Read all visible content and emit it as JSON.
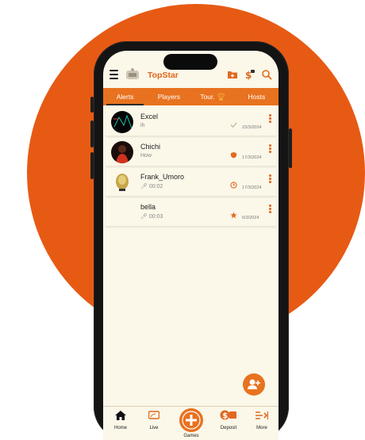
{
  "app": {
    "title": "TopStar"
  },
  "tabs": [
    {
      "label": "Alerts",
      "active": true
    },
    {
      "label": "Players",
      "active": false
    },
    {
      "label": "Tour.",
      "active": false
    },
    {
      "label": "Hosts",
      "active": false
    }
  ],
  "alerts": [
    {
      "name": "Excel",
      "subtitle": "ih",
      "status_icon": "check-icon",
      "date": "23/3/2024"
    },
    {
      "name": "Chichi",
      "subtitle": "How",
      "status_icon": "shield-icon",
      "date": "17/3/2024"
    },
    {
      "name": "Frank_Umoro",
      "subtitle": "00:02",
      "status_icon": "clock-icon",
      "date": "17/3/2024"
    },
    {
      "name": "bella",
      "subtitle": "00:03",
      "status_icon": "star-icon",
      "date": "6/3/2024"
    }
  ],
  "bottom_nav": [
    {
      "label": "Home",
      "icon": "home-icon"
    },
    {
      "label": "Live",
      "icon": "tv-icon"
    },
    {
      "label": "Games",
      "icon": "gamepad-icon"
    },
    {
      "label": "Deposit",
      "icon": "deposit-icon"
    },
    {
      "label": "More",
      "icon": "more-icon"
    }
  ],
  "colors": {
    "accent": "#e8721f",
    "background_circle": "#e75a14",
    "screen": "#fbf7e9"
  }
}
